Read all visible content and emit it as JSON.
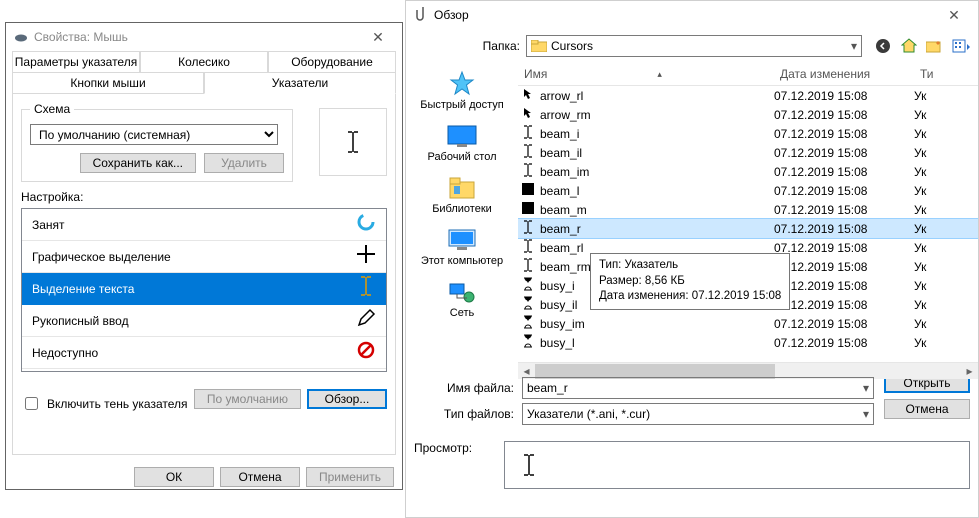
{
  "props": {
    "title": "Свойства: Мышь",
    "tabs_top": [
      "Параметры указателя",
      "Колесико",
      "Оборудование"
    ],
    "tabs_bottom": [
      "Кнопки мыши",
      "Указатели"
    ],
    "scheme_label": "Схема",
    "scheme_value": "По умолчанию (системная)",
    "save_as": "Сохранить как...",
    "delete": "Удалить",
    "settings_label": "Настройка:",
    "list": [
      {
        "label": "Занят",
        "icon": "ring"
      },
      {
        "label": "Графическое выделение",
        "icon": "cross"
      },
      {
        "label": "Выделение текста",
        "icon": "ibeam",
        "selected": true
      },
      {
        "label": "Рукописный ввод",
        "icon": "pencil"
      },
      {
        "label": "Недоступно",
        "icon": "no"
      }
    ],
    "shadow": "Включить тень указателя",
    "default_btn": "По умолчанию",
    "browse_btn": "Обзор...",
    "ok": "ОК",
    "cancel": "Отмена",
    "apply": "Применить"
  },
  "browse": {
    "title": "Обзор",
    "folder_label": "Папка:",
    "folder_value": "Cursors",
    "cols": {
      "name": "Имя",
      "date": "Дата изменения",
      "type": "Ти"
    },
    "places": [
      {
        "label": "Быстрый доступ",
        "icon": "star"
      },
      {
        "label": "Рабочий стол",
        "icon": "desktop"
      },
      {
        "label": "Библиотеки",
        "icon": "libs"
      },
      {
        "label": "Этот компьютер",
        "icon": "pc"
      },
      {
        "label": "Сеть",
        "icon": "net"
      }
    ],
    "files": [
      {
        "name": "arrow_rl",
        "date": "07.12.2019 15:08",
        "type": "Ук",
        "icon": "arrow"
      },
      {
        "name": "arrow_rm",
        "date": "07.12.2019 15:08",
        "type": "Ук",
        "icon": "arrow"
      },
      {
        "name": "beam_i",
        "date": "07.12.2019 15:08",
        "type": "Ук",
        "icon": "ibeam"
      },
      {
        "name": "beam_il",
        "date": "07.12.2019 15:08",
        "type": "Ук",
        "icon": "ibeam"
      },
      {
        "name": "beam_im",
        "date": "07.12.2019 15:08",
        "type": "Ук",
        "icon": "ibeam"
      },
      {
        "name": "beam_l",
        "date": "07.12.2019 15:08",
        "type": "Ук",
        "icon": "blk"
      },
      {
        "name": "beam_m",
        "date": "07.12.2019 15:08",
        "type": "Ук",
        "icon": "blk"
      },
      {
        "name": "beam_r",
        "date": "07.12.2019 15:08",
        "type": "Ук",
        "icon": "ibeam",
        "selected": true
      },
      {
        "name": "beam_rl",
        "date": "07.12.2019 15:08",
        "type": "Ук",
        "icon": "ibeam"
      },
      {
        "name": "beam_rm",
        "date": "07.12.2019 15:08",
        "type": "Ук",
        "icon": "ibeam"
      },
      {
        "name": "busy_i",
        "date": "07.12.2019 15:08",
        "type": "Ук",
        "icon": "hour"
      },
      {
        "name": "busy_il",
        "date": "07.12.2019 15:08",
        "type": "Ук",
        "icon": "hour"
      },
      {
        "name": "busy_im",
        "date": "07.12.2019 15:08",
        "type": "Ук",
        "icon": "hour"
      },
      {
        "name": "busy_l",
        "date": "07.12.2019 15:08",
        "type": "Ук",
        "icon": "hour"
      }
    ],
    "tooltip": {
      "line1": "Тип: Указатель",
      "line2": "Размер: 8,56 КБ",
      "line3": "Дата изменения: 07.12.2019 15:08"
    },
    "filename_label": "Имя файла:",
    "filename_value": "beam_r",
    "filetype_label": "Тип файлов:",
    "filetype_value": "Указатели (*.ani, *.cur)",
    "open": "Открыть",
    "cancel": "Отмена",
    "preview_label": "Просмотр:"
  }
}
